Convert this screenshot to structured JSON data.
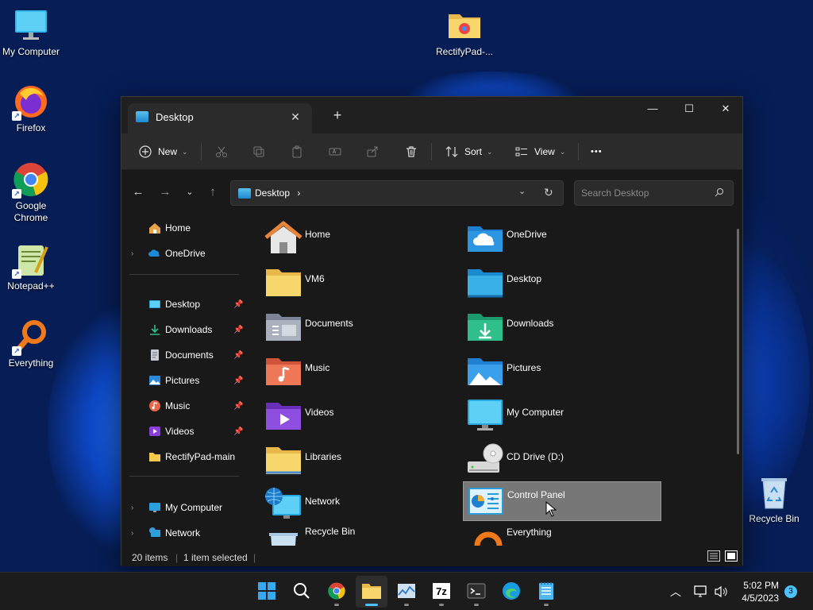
{
  "desktop": {
    "icons": [
      {
        "label": "My Computer",
        "icon": "monitor-icon"
      },
      {
        "label": "RectifyPad-...",
        "icon": "folder-icon"
      },
      {
        "label": "Firefox",
        "icon": "firefox-icon"
      },
      {
        "label": "Google Chrome",
        "icon": "chrome-icon"
      },
      {
        "label": "Notepad++",
        "icon": "notepadpp-icon"
      },
      {
        "label": "Everything",
        "icon": "everything-icon"
      },
      {
        "label": "Recycle Bin",
        "icon": "recycle-bin-icon"
      }
    ]
  },
  "window": {
    "tab_title": "Desktop",
    "close_tab_glyph": "✕",
    "new_tab_glyph": "+",
    "minimize_glyph": "—",
    "maximize_glyph": "☐",
    "close_glyph": "✕"
  },
  "toolbar": {
    "new_label": "New",
    "sort_label": "Sort",
    "view_label": "View",
    "more_glyph": "•••"
  },
  "address": {
    "path": "Desktop",
    "separator": "›",
    "search_placeholder": "Search Desktop"
  },
  "navpane": {
    "top": [
      {
        "label": "Home",
        "icon": "home-icon"
      },
      {
        "label": "OneDrive",
        "icon": "onedrive-icon"
      }
    ],
    "quick_access": [
      {
        "label": "Desktop",
        "icon": "desktop-icon",
        "pinned": true
      },
      {
        "label": "Downloads",
        "icon": "downloads-icon",
        "pinned": true
      },
      {
        "label": "Documents",
        "icon": "documents-icon",
        "pinned": true
      },
      {
        "label": "Pictures",
        "icon": "pictures-icon",
        "pinned": true
      },
      {
        "label": "Music",
        "icon": "music-icon",
        "pinned": true
      },
      {
        "label": "Videos",
        "icon": "videos-icon",
        "pinned": true
      },
      {
        "label": "RectifyPad-main",
        "icon": "folder-icon",
        "pinned": false
      }
    ],
    "bottom": [
      {
        "label": "My Computer",
        "icon": "monitor-icon"
      },
      {
        "label": "Network",
        "icon": "network-icon"
      }
    ]
  },
  "files": [
    {
      "label": "Home",
      "icon": "home-icon"
    },
    {
      "label": "OneDrive",
      "icon": "onedrive-icon"
    },
    {
      "label": "VM6",
      "icon": "folder-icon"
    },
    {
      "label": "Desktop",
      "icon": "desktop-folder-icon"
    },
    {
      "label": "Documents",
      "icon": "documents-folder-icon"
    },
    {
      "label": "Downloads",
      "icon": "downloads-folder-icon"
    },
    {
      "label": "Music",
      "icon": "music-folder-icon"
    },
    {
      "label": "Pictures",
      "icon": "pictures-folder-icon"
    },
    {
      "label": "Videos",
      "icon": "videos-folder-icon"
    },
    {
      "label": "My Computer",
      "icon": "monitor-icon"
    },
    {
      "label": "Libraries",
      "icon": "libraries-folder-icon"
    },
    {
      "label": "CD Drive (D:)",
      "icon": "cd-drive-icon"
    },
    {
      "label": "Network",
      "icon": "network-icon"
    },
    {
      "label": "Control Panel",
      "icon": "control-panel-icon",
      "selected": true
    },
    {
      "label": "Recycle Bin",
      "icon": "recycle-bin-icon"
    },
    {
      "label": "Everything",
      "icon": "everything-icon"
    }
  ],
  "status": {
    "item_count": "20 items",
    "selection": "1 item selected"
  },
  "taskbar": {
    "apps": [
      "start-icon",
      "search-icon",
      "chrome-icon",
      "file-explorer-icon",
      "task-manager-icon",
      "7zip-icon",
      "terminal-icon",
      "edge-icon",
      "notepad-icon"
    ],
    "time": "5:02 PM",
    "date": "4/5/2023",
    "notification_count": "3"
  },
  "colors": {
    "accent": "#4cc2ff",
    "window_bg": "#191919",
    "toolbar_bg": "#2b2b2b",
    "selection": "#777777"
  }
}
